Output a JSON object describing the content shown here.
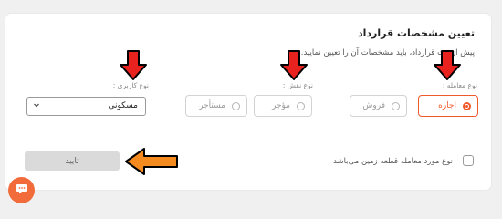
{
  "form": {
    "title": "تعیین مشخصات قرارداد",
    "subtitle": "پیش از ثبت قرارداد، باید مشخصات آن را تعیین نمایید.",
    "transaction": {
      "label": "نوع معامله :",
      "options": [
        "اجاره",
        "فروش"
      ],
      "selected": "اجاره"
    },
    "role": {
      "label": "نوع نقش :",
      "options": [
        "مؤجر",
        "مستأجر"
      ]
    },
    "usage": {
      "label": "نوع کاربری :",
      "value": "مسکونی"
    },
    "land_checkbox_label": "نوع مورد معامله قطعه زمین می‌باشد",
    "confirm_label": "تایید"
  },
  "colors": {
    "accent": "#f05a2b",
    "annotation_arrow_red": "#e8231f",
    "annotation_arrow_orange": "#f58a1f",
    "chat_button": "#f26b3a"
  },
  "icons": [
    "chevron-down-icon",
    "chat-icon"
  ]
}
